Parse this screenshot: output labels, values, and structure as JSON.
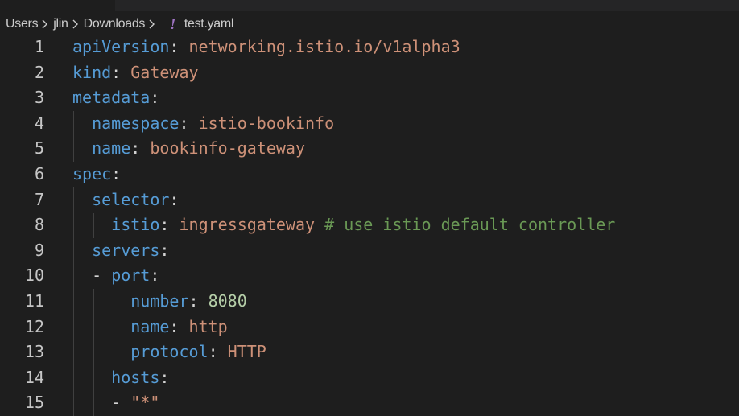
{
  "breadcrumb": {
    "items": [
      "Users",
      "jlin",
      "Downloads"
    ],
    "file_icon": "!",
    "file_name": "test.yaml"
  },
  "colors": {
    "key": "#569cd6",
    "string": "#ce9178",
    "number": "#b5cea8",
    "comment": "#6a9955",
    "yaml_icon": "#a074c4"
  },
  "lines": [
    {
      "num": "1",
      "indent": "",
      "dash": "",
      "key": "apiVersion",
      "colon": ":",
      "value": "networking.istio.io/v1alpha3",
      "vtype": "s",
      "comment": ""
    },
    {
      "num": "2",
      "indent": "",
      "dash": "",
      "key": "kind",
      "colon": ":",
      "value": "Gateway",
      "vtype": "s",
      "comment": ""
    },
    {
      "num": "3",
      "indent": "",
      "dash": "",
      "key": "metadata",
      "colon": ":",
      "value": "",
      "vtype": "s",
      "comment": ""
    },
    {
      "num": "4",
      "indent": "  ",
      "dash": "",
      "key": "namespace",
      "colon": ":",
      "value": "istio-bookinfo",
      "vtype": "s",
      "comment": ""
    },
    {
      "num": "5",
      "indent": "  ",
      "dash": "",
      "key": "name",
      "colon": ":",
      "value": "bookinfo-gateway",
      "vtype": "s",
      "comment": ""
    },
    {
      "num": "6",
      "indent": "",
      "dash": "",
      "key": "spec",
      "colon": ":",
      "value": "",
      "vtype": "s",
      "comment": ""
    },
    {
      "num": "7",
      "indent": "  ",
      "dash": "",
      "key": "selector",
      "colon": ":",
      "value": "",
      "vtype": "s",
      "comment": ""
    },
    {
      "num": "8",
      "indent": "    ",
      "dash": "",
      "key": "istio",
      "colon": ":",
      "value": "ingressgateway",
      "vtype": "s",
      "comment": "# use istio default controller"
    },
    {
      "num": "9",
      "indent": "  ",
      "dash": "",
      "key": "servers",
      "colon": ":",
      "value": "",
      "vtype": "s",
      "comment": ""
    },
    {
      "num": "10",
      "indent": "  ",
      "dash": "- ",
      "key": "port",
      "colon": ":",
      "value": "",
      "vtype": "s",
      "comment": ""
    },
    {
      "num": "11",
      "indent": "      ",
      "dash": "",
      "key": "number",
      "colon": ":",
      "value": "8080",
      "vtype": "n",
      "comment": ""
    },
    {
      "num": "12",
      "indent": "      ",
      "dash": "",
      "key": "name",
      "colon": ":",
      "value": "http",
      "vtype": "s",
      "comment": ""
    },
    {
      "num": "13",
      "indent": "      ",
      "dash": "",
      "key": "protocol",
      "colon": ":",
      "value": "HTTP",
      "vtype": "s",
      "comment": ""
    },
    {
      "num": "14",
      "indent": "    ",
      "dash": "",
      "key": "hosts",
      "colon": ":",
      "value": "",
      "vtype": "s",
      "comment": ""
    },
    {
      "num": "15",
      "indent": "    ",
      "dash": "- ",
      "key": "",
      "colon": "",
      "value": "\"*\"",
      "vtype": "s",
      "comment": ""
    }
  ]
}
